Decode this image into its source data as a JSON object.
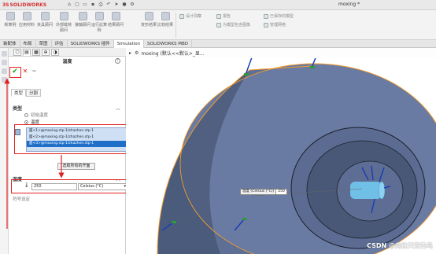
{
  "app": {
    "brand": "SOLIDWORKS",
    "brand_prefix": "3S",
    "document_title": "moxing *"
  },
  "quick_access": [
    "new-icon",
    "open-icon",
    "save-icon",
    "print-icon",
    "undo-icon",
    "select-icon",
    "rebuild-icon",
    "options-icon"
  ],
  "ribbon": {
    "groups": [
      {
        "label": "新算例"
      },
      {
        "label": "应用材料"
      },
      {
        "label": "夹具顾问"
      },
      {
        "label": "外部载荷顾问"
      },
      {
        "label": "接触顾问"
      },
      {
        "label": "运行此算例"
      },
      {
        "label": "结果顾问"
      },
      {
        "label": "变形结果"
      },
      {
        "label": "比较结果"
      }
    ],
    "small_items": [
      "设计洞察",
      "报告",
      "已保存的模型",
      "为模型包含图像",
      "管理网络"
    ]
  },
  "command_tabs": [
    {
      "label": "装配体",
      "active": false
    },
    {
      "label": "布局",
      "active": false
    },
    {
      "label": "草图",
      "active": false
    },
    {
      "label": "评估",
      "active": false
    },
    {
      "label": "SOLIDWORKS 插件",
      "active": false
    },
    {
      "label": "Simulation",
      "active": true
    },
    {
      "label": "SOLIDWORKS MBD",
      "active": false
    }
  ],
  "property_manager": {
    "title": "温度",
    "help": "?",
    "ok_icon": "checkmark-icon",
    "cancel_icon": "close-icon",
    "pin_icon": "pushpin-icon",
    "sub_tabs": [
      {
        "label": "类型",
        "active": true
      },
      {
        "label": "分割",
        "active": false
      }
    ],
    "type_section": {
      "heading": "类型",
      "options": [
        {
          "label": "初始温度",
          "selected": false
        },
        {
          "label": "温度",
          "selected": true
        }
      ]
    },
    "faces": [
      {
        "label": "面<1>@moxing.stp-1/zhazhen.stp-1",
        "selected": false
      },
      {
        "label": "面<2>@moxing.stp-1/zhazhen.stp-1",
        "selected": false
      },
      {
        "label": "面<3>@moxing.stp-1/zhazhen.stp-1",
        "selected": true
      }
    ],
    "open_button": "选取所有的开面",
    "temperature_section": {
      "heading": "温度",
      "value": "250",
      "unit": "Celsius (°C)"
    },
    "sign_note": "符号设定"
  },
  "viewport": {
    "tree_root": "moxing (默认<<默认>_显...",
    "dimension": {
      "label": "温度 (Celsius (°C))",
      "value": "250"
    }
  },
  "watermark": "CSDN @向往天空的鸟",
  "colors": {
    "part_fill": "#5d6f95",
    "part_shadow": "#3c4a66",
    "edge_highlight": "#f39c2c",
    "selection_blue": "#1f6fc9",
    "callout_red": "#e02020",
    "arrow_blue": "#1d3fb5",
    "anchor_green": "#2f9a3a",
    "bore_cyan": "#6fbfe6"
  }
}
